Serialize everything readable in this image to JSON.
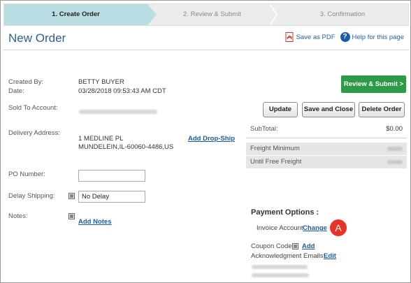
{
  "wizard": {
    "steps": [
      "1. Create Order",
      "2. Review & Submit",
      "3. Confirmation"
    ]
  },
  "page_title": "New Order",
  "top_links": {
    "save_pdf": "Save as PDF",
    "help": "Help for this page",
    "help_glyph": "?"
  },
  "order_info": {
    "created_by_label": "Created By:",
    "created_by": "BETTY  BUYER",
    "date_label": "Date:",
    "date": "03/28/2018 09:53:43 AM CDT",
    "sold_to_label": "Sold To Account:",
    "delivery_label": "Delivery Address:",
    "delivery_line1": "1 MEDLINE PL",
    "delivery_line2": "MUNDELEIN,IL-60060-4486,US",
    "add_dropship": "Add Drop-Ship",
    "po_label": "PO Number:",
    "po_value": "",
    "delay_label": "Delay Shipping:",
    "delay_value": "No Delay",
    "notes_label": "Notes:",
    "add_notes": "Add Notes"
  },
  "actions": {
    "review_submit": "Review & Submit >",
    "update": "Update",
    "save_close": "Save and Close",
    "delete_order": "Delete Order"
  },
  "summary": {
    "subtotal_label": "SubTotal:",
    "subtotal": "$0.00",
    "freight_min_label": "Freight Minimum",
    "until_free_label": "Until Free Freight"
  },
  "payment": {
    "title": "Payment Options :",
    "method": "Invoice Account",
    "change": "Change",
    "badge": "A",
    "coupon_label": "Coupon Code:",
    "coupon_add": "Add",
    "ack_label": "Acknowledgment Emails:",
    "ack_edit": "Edit"
  },
  "colors": {
    "accent": "#2d9a45",
    "link": "#1c5ba8",
    "title": "#2f5f8a",
    "badge": "#e8332b",
    "active_step": "#b9dde2"
  },
  "icons": [
    "pdf-icon",
    "help-icon",
    "info-icon"
  ]
}
